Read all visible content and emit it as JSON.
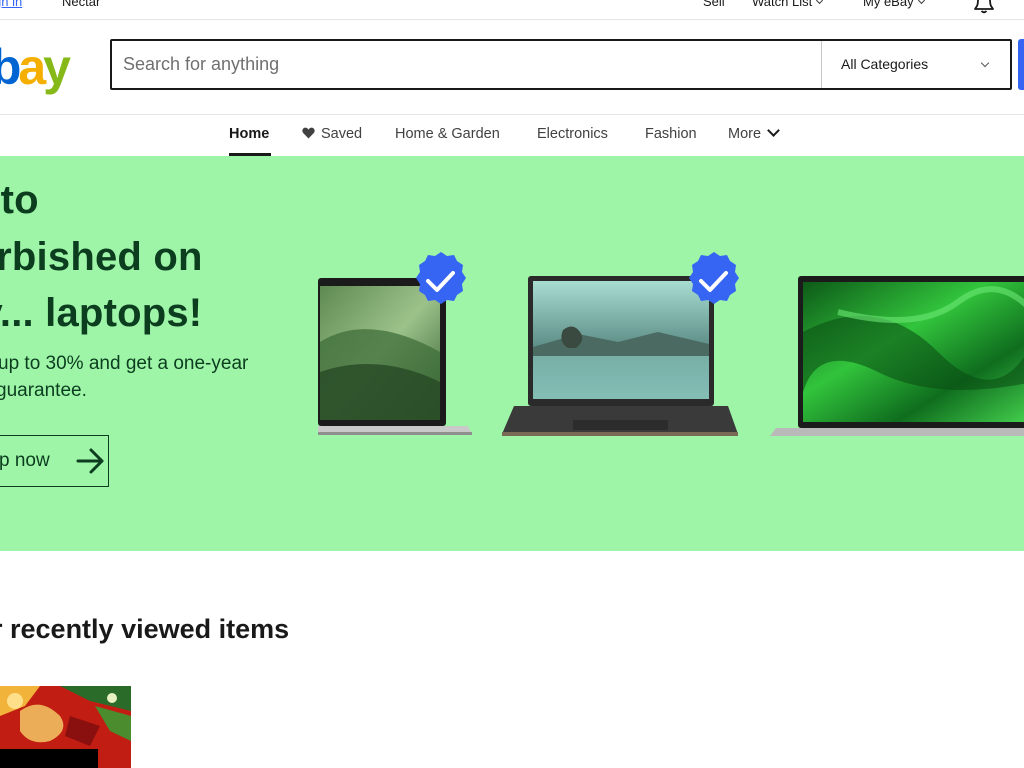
{
  "topbar": {
    "sign_in": "gn in",
    "promo": "Nectar",
    "sell": "Sell",
    "watch_list": "Watch List",
    "my_ebay": "My eBay"
  },
  "header": {
    "logo_text": "ebay",
    "search_placeholder": "Search for anything",
    "category_selected": "All Categories"
  },
  "nav": {
    "items": [
      {
        "label": "Home"
      },
      {
        "label": "Saved"
      },
      {
        "label": "Home & Garden"
      },
      {
        "label": "Electronics"
      },
      {
        "label": "Fashion"
      },
      {
        "label": "More"
      }
    ]
  },
  "hero": {
    "title_lines": [
      "w to",
      "furbished on",
      "ay... laptops!"
    ],
    "subtitle_lines": [
      "up to 30% and get a one-year",
      "guarantee."
    ],
    "cta_label": "p now"
  },
  "recently_viewed": {
    "title": "r recently viewed items"
  },
  "colors": {
    "brand_blue": "#3665f3",
    "logo_red": "#e53238",
    "logo_blue": "#0064d2",
    "logo_yellow": "#f5af02",
    "logo_green": "#86b817",
    "hero_bg": "#9ef5a8",
    "hero_text": "#0b3d1e",
    "badge_blue": "#3665f3"
  },
  "icons": {
    "bell": "bell-icon",
    "heart": "heart-icon",
    "arrow": "arrow-right-icon",
    "verified": "verified-check-icon"
  }
}
